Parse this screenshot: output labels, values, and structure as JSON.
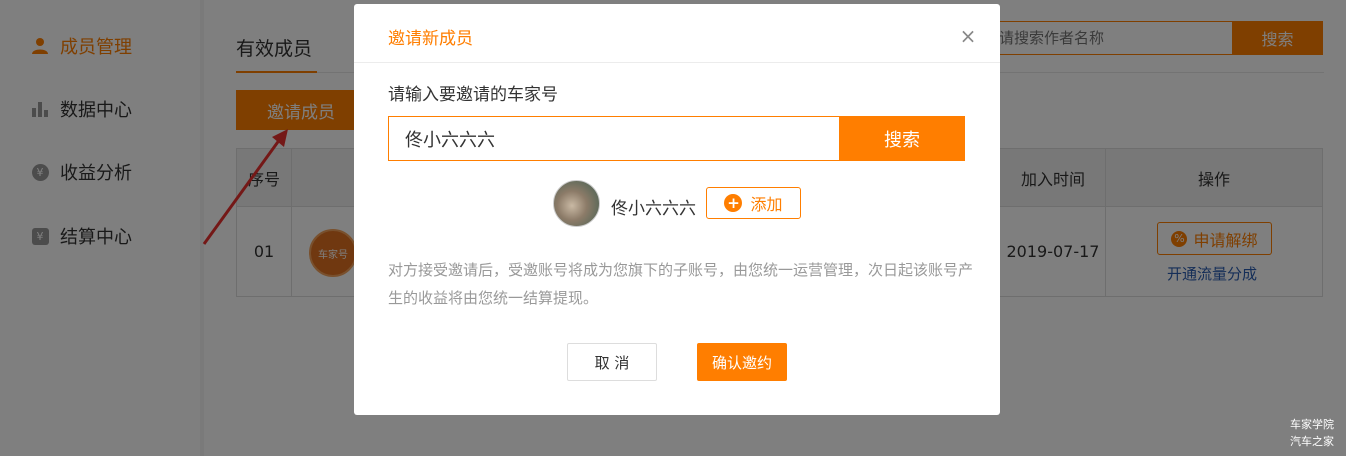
{
  "sidebar": {
    "items": [
      {
        "label": "成员管理",
        "icon": "user-icon",
        "active": true
      },
      {
        "label": "数据中心",
        "icon": "bar-chart-icon",
        "active": false
      },
      {
        "label": "收益分析",
        "icon": "yuan-circle-icon",
        "active": false
      },
      {
        "label": "结算中心",
        "icon": "yuan-square-icon",
        "active": false
      }
    ],
    "yuan_glyph": "¥"
  },
  "main": {
    "tab": "有效成员",
    "search": {
      "placeholder": "请搜索作者名称",
      "button": "搜索"
    },
    "invite_button": "邀请成员",
    "table": {
      "headers": {
        "index": "序号",
        "join_time": "加入时间",
        "actions": "操作"
      },
      "rows": [
        {
          "index": "01",
          "avatar_text": "车家号",
          "join_time": "2019-07-17",
          "unbind_label": "申请解绑",
          "share_link": "开通流量分成"
        }
      ]
    }
  },
  "modal": {
    "title": "邀请新成员",
    "close_symbol": "×",
    "label": "请输入要邀请的车家号",
    "input_value": "佟小六六六",
    "search_button": "搜索",
    "result": {
      "name": "佟小六六六",
      "add_button": "添加",
      "add_symbol": "+"
    },
    "note": "对方接受邀请后，受邀账号将成为您旗下的子账号，由您统一运营管理，次日起该账号产生的收益将由您统一结算提现。",
    "cancel_button": "取 消",
    "confirm_button": "确认邀约"
  },
  "corner_mark": [
    "车家学院",
    "汽车之家"
  ],
  "colors": {
    "accent": "#ff7e00",
    "link": "#2a5db0",
    "arrow": "#e8312f"
  }
}
